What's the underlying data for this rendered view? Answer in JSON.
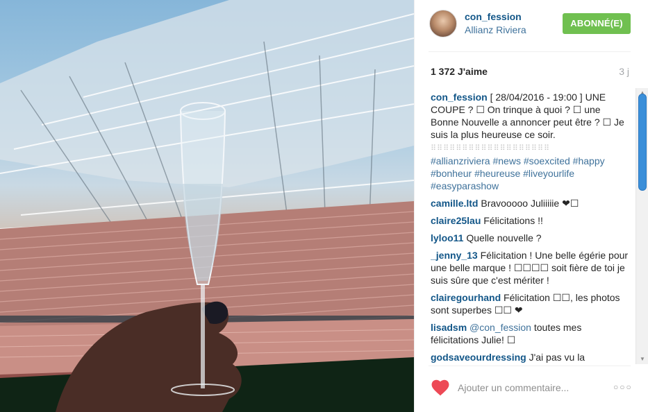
{
  "post": {
    "username": "con_fession",
    "location": "Allianz Riviera",
    "follow_label": "ABONNÉ(E)",
    "likes": "1 372 J'aime",
    "age": "3 j"
  },
  "caption": {
    "user": "con_fession",
    "text": "[      28/04/2016 - 19:00 ] UNE COUPE ? ☐ On trinque à quoi ? ☐ une Bonne Nouvelle a annoncer peut être ? ☐ Je suis la plus heureuse ce soir.",
    "dots": "⠿⠿⠿⠿⠿⠿⠿⠿⠿⠿⠿⠿⠿⠿⠿⠿⠿⠿⠿",
    "hashtags": [
      "#allianzriviera",
      "#news",
      "#soexcited",
      "#happy",
      "#bonheur",
      "#heureuse",
      "#liveyourlife",
      "#easyparashow"
    ]
  },
  "comments": [
    {
      "user": "camille.ltd",
      "text": "Bravooooo Juliiiiie ❤☐"
    },
    {
      "user": "claire25lau",
      "text": "Félicitations !!"
    },
    {
      "user": "lyloo11",
      "text": "Quelle nouvelle ?"
    },
    {
      "user": "_jenny_13",
      "text": "Félicitation ! Une belle égérie pour une belle marque ! ☐☐☐☐ soit fière de toi je suis sûre que c'est mériter !"
    },
    {
      "user": "clairegourhand",
      "text": "Félicitation ☐☐, les photos sont superbes ☐☐ ❤"
    },
    {
      "user": "lisadsm",
      "mention": "@con_fession",
      "text": " toutes mes félicitations Julie! ☐"
    },
    {
      "user": "godsaveourdressing",
      "text": "J'ai pas vu la"
    }
  ],
  "footer": {
    "placeholder": "Ajouter un commentaire...",
    "more_label": "○○○"
  },
  "icons": {
    "heart": "heart-icon",
    "more": "more-options-icon",
    "avatar": "avatar"
  },
  "colors": {
    "follow_green": "#70c050",
    "username_blue": "#125688",
    "link_blue": "#3f729b",
    "heart_red": "#ed4956"
  }
}
